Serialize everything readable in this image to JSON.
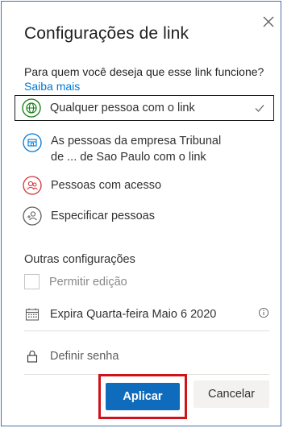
{
  "dialog": {
    "title": "Configurações de link",
    "question": "Para quem você deseja que esse link funcione?",
    "learn_more": "Saiba mais"
  },
  "options": [
    {
      "label": "Qualquer pessoa com o link",
      "icon": "globe-icon",
      "color": "#107c10",
      "selected": true
    },
    {
      "label_line1": "As pessoas da empresa Tribunal",
      "label_line2": "de ... de Sao Paulo com o link",
      "icon": "building-icon",
      "color": "#0078d4"
    },
    {
      "label": "Pessoas com acesso",
      "icon": "people-icon",
      "color": "#d13438"
    },
    {
      "label": "Especificar pessoas",
      "icon": "person-add-icon",
      "color": "#605e5c"
    }
  ],
  "other": {
    "title": "Outras configurações",
    "allow_edit_label": "Permitir edição",
    "allow_edit_checked": false,
    "expiry_label": "Expira Quarta-feira Maio 6 2020",
    "password_label": "Definir senha"
  },
  "buttons": {
    "apply": "Aplicar",
    "cancel": "Cancelar"
  },
  "colors": {
    "accent": "#0f6cbd",
    "highlight_border": "#d0121b"
  }
}
